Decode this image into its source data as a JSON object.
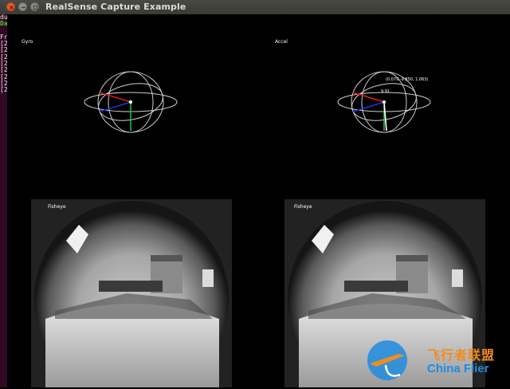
{
  "window": {
    "title": "RealSense Capture Example",
    "buttons": [
      "close",
      "minimize",
      "maximize"
    ]
  },
  "terminal": {
    "lines": [
      "du",
      "Da",
      "",
      "Fr",
      "[2",
      "[2",
      "[2",
      "[2",
      "[2",
      "[2",
      "[2",
      "[2"
    ]
  },
  "gyro": {
    "label": "Gyro"
  },
  "accel": {
    "label": "Accel",
    "vector_text": "(0.079,-9.850, 1.063)",
    "magnitude_text": "9.91"
  },
  "fisheye_left": {
    "label": "Fisheye"
  },
  "fisheye_right": {
    "label": "Fisheye"
  },
  "watermark": {
    "chinese": "飞行者联盟",
    "english": "China Flier"
  },
  "colors": {
    "x_axis": "#e01e1e",
    "y_axis": "#22c83c",
    "z_axis": "#2233e0",
    "ring": "#cfcfcf",
    "brand_orange": "#f08c1e",
    "brand_blue": "#1e8ce0"
  }
}
